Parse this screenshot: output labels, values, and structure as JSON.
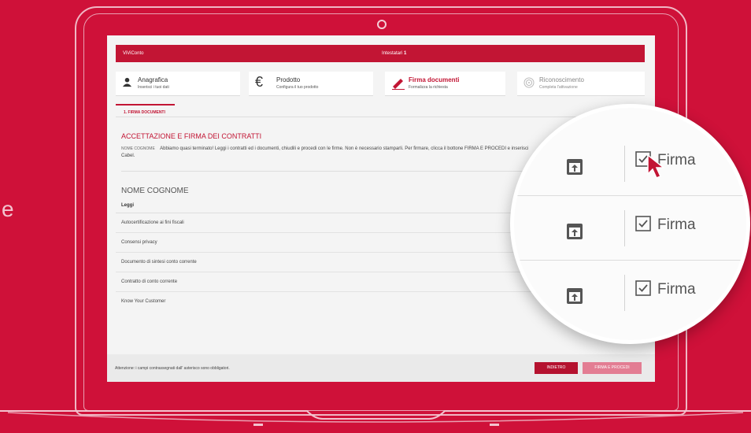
{
  "background": {
    "partial_letter": "e",
    "brand_color": "#cf1139"
  },
  "app": {
    "brand": "ViViConto",
    "holders_label": "Intestatari",
    "holders_count": "1"
  },
  "steps": [
    {
      "icon": "person-icon",
      "title": "Anagrafica",
      "subtitle": "Inserisci i tuoi dati"
    },
    {
      "icon": "euro-icon",
      "title": "Prodotto",
      "subtitle": "Configura il tuo prodotto"
    },
    {
      "icon": "pen-icon",
      "title": "Firma documenti",
      "subtitle": "Formalizza la richiesta"
    },
    {
      "icon": "fingerprint-icon",
      "title": "Riconoscimento",
      "subtitle": "Completa l'attivazione"
    }
  ],
  "tab": {
    "label": "1. FIRMA DOCUMENTI"
  },
  "content": {
    "section_title": "ACCETTAZIONE E FIRMA DEI CONTRATTI",
    "intro_name": "NOME COGNOME",
    "intro_text": "Abbiamo quasi terminato! Leggi i contratti ed i documenti, chiudili e procedi con le firme. Non è necessario stamparli. Per firmare, clicca il bottone FIRMA E PROCEDI e inserisci",
    "intro_text_cont": "Cabel.",
    "customer_name": "NOME COGNOME",
    "list_header": "Leggi",
    "documents": [
      "Autocertificazione ai fini fiscali",
      "Consensi privacy",
      "Documento di sintesi conto corrente",
      "Contratto di conto corrente",
      "Know Your Customer"
    ]
  },
  "footer": {
    "note": "Attenzione: i campi contrassegnati dall' asterisco sono obbligatori.",
    "back_label": "INDIETRO",
    "sign_label": "FIRMA E PROCEDI"
  },
  "magnifier": {
    "rows": [
      {
        "label": "Firma",
        "checked": true
      },
      {
        "label": "Firma",
        "checked": true
      },
      {
        "label": "Firma",
        "checked": true
      }
    ]
  }
}
